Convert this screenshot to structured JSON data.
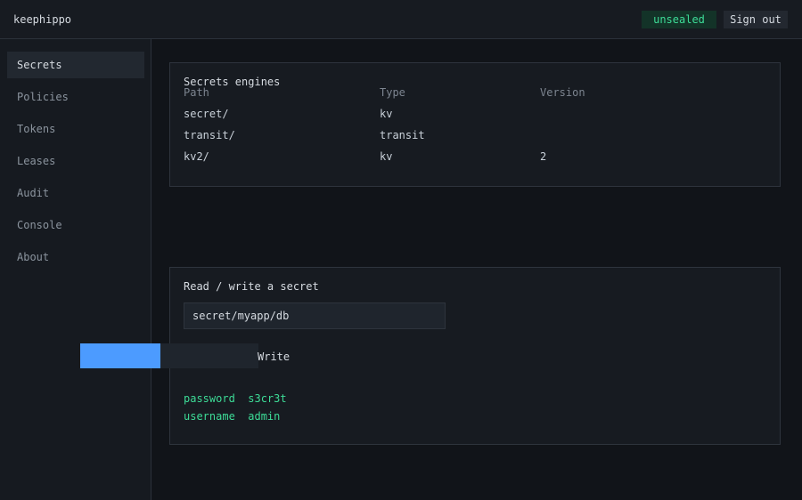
{
  "header": {
    "brand": "keephippo",
    "seal_status": "unsealed",
    "signout_label": "Sign out"
  },
  "sidebar": {
    "items": [
      {
        "label": "Secrets",
        "active": true
      },
      {
        "label": "Policies"
      },
      {
        "label": "Tokens"
      },
      {
        "label": "Leases"
      },
      {
        "label": "Audit"
      },
      {
        "label": "Console"
      },
      {
        "label": "About"
      }
    ]
  },
  "engines": {
    "title": "Secrets engines",
    "columns": [
      "Path",
      "Type",
      "Version"
    ],
    "rows": [
      {
        "path": "secret/",
        "type": "kv",
        "version": ""
      },
      {
        "path": "transit/",
        "type": "transit",
        "version": ""
      },
      {
        "path": "kv2/",
        "type": "kv",
        "version": "2"
      }
    ]
  },
  "secret_form": {
    "title": "Read / write a secret",
    "path_value": "secret/myapp/db",
    "write_label": "Write",
    "result": [
      {
        "key": "password",
        "value": "s3cr3t"
      },
      {
        "key": "username",
        "value": "admin"
      }
    ]
  },
  "colors": {
    "accent": "#4c9bff",
    "success": "#3ddc97",
    "background": "#111419"
  }
}
